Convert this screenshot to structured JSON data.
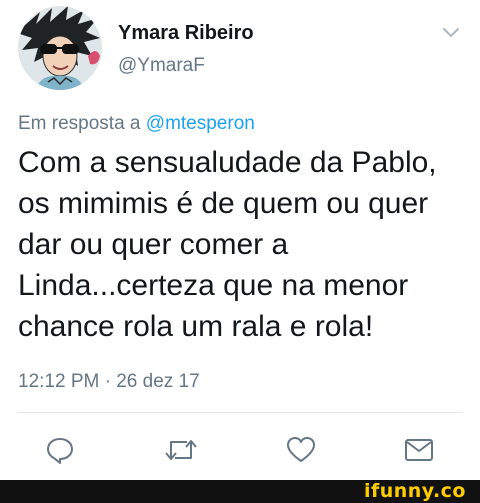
{
  "tweet": {
    "author_name": "Ymara Ribeiro",
    "author_handle": "@YmaraF",
    "reply_prefix": "Em resposta a",
    "reply_to": "@mtesperon",
    "text": "Com a sensualudade da Pablo, os mimimis é de quem ou quer dar ou quer comer a Linda...certeza que na menor chance rola um rala e rola!",
    "timestamp": "12:12 PM · 26 dez 17"
  },
  "actions": {
    "icons": [
      "reply-icon",
      "retweet-icon",
      "like-icon",
      "direct-message-icon"
    ]
  },
  "watermark": {
    "text": "ifunny.co"
  },
  "colors": {
    "text": "#14171a",
    "secondary": "#657786",
    "link": "#1da1f2",
    "divider": "#e1e8ed",
    "watermark_bar": "#111111",
    "watermark_text": "#ffcc00"
  }
}
